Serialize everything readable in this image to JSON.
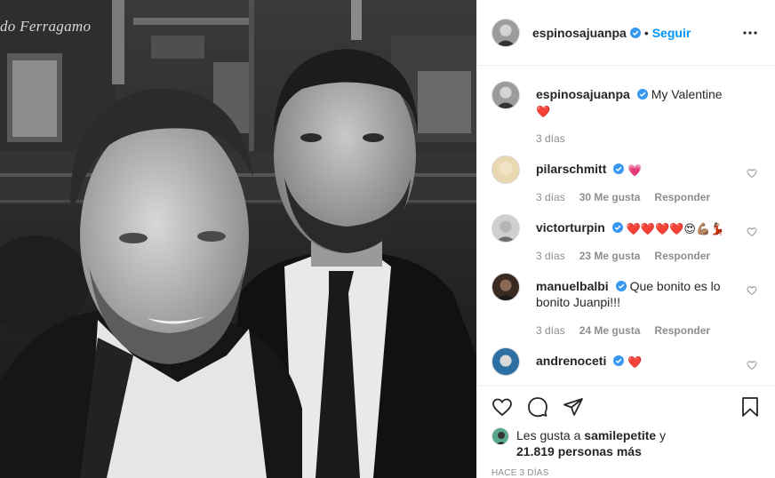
{
  "post": {
    "author": "espinosajuanpa",
    "follow_label": "Seguir",
    "dot": "•",
    "photo_sign": "do Ferragamo",
    "caption": {
      "username": "espinosajuanpa",
      "text": "My Valentine",
      "emoji": "❤️",
      "time": "3 días"
    }
  },
  "comments": [
    {
      "username": "pilarschmitt",
      "text": "",
      "emoji": "💗",
      "time": "3 días",
      "likes": "30 Me gusta",
      "reply": "Responder"
    },
    {
      "username": "victorturpin",
      "text": "",
      "emoji": "❤️❤️❤️❤️😍💪🏽💃🏽",
      "time": "3 días",
      "likes": "23 Me gusta",
      "reply": "Responder"
    },
    {
      "username": "manuelbalbi",
      "text": "Que bonito es lo bonito Juanpi!!!",
      "emoji": "",
      "time": "3 días",
      "likes": "24 Me gusta",
      "reply": "Responder"
    },
    {
      "username": "andrenoceti",
      "text": "",
      "emoji": "❤️",
      "time": "",
      "likes": "",
      "reply": ""
    }
  ],
  "footer": {
    "likes_prefix": "Les gusta a",
    "liker": "samilepetite",
    "likes_mid": "y",
    "others": "21.819 personas más",
    "timestamp": "HACE 3 DÍAS"
  },
  "icons": {
    "verified": "verified-badge-icon",
    "more": "more-options-icon",
    "like": "heart-icon",
    "comment": "comment-icon",
    "share": "share-icon",
    "save": "bookmark-icon",
    "comment_like": "small-heart-icon"
  },
  "colors": {
    "accent": "#0095f6",
    "heart": "#ed4956",
    "secondary_text": "#8e8e8e",
    "border": "#efefef"
  }
}
